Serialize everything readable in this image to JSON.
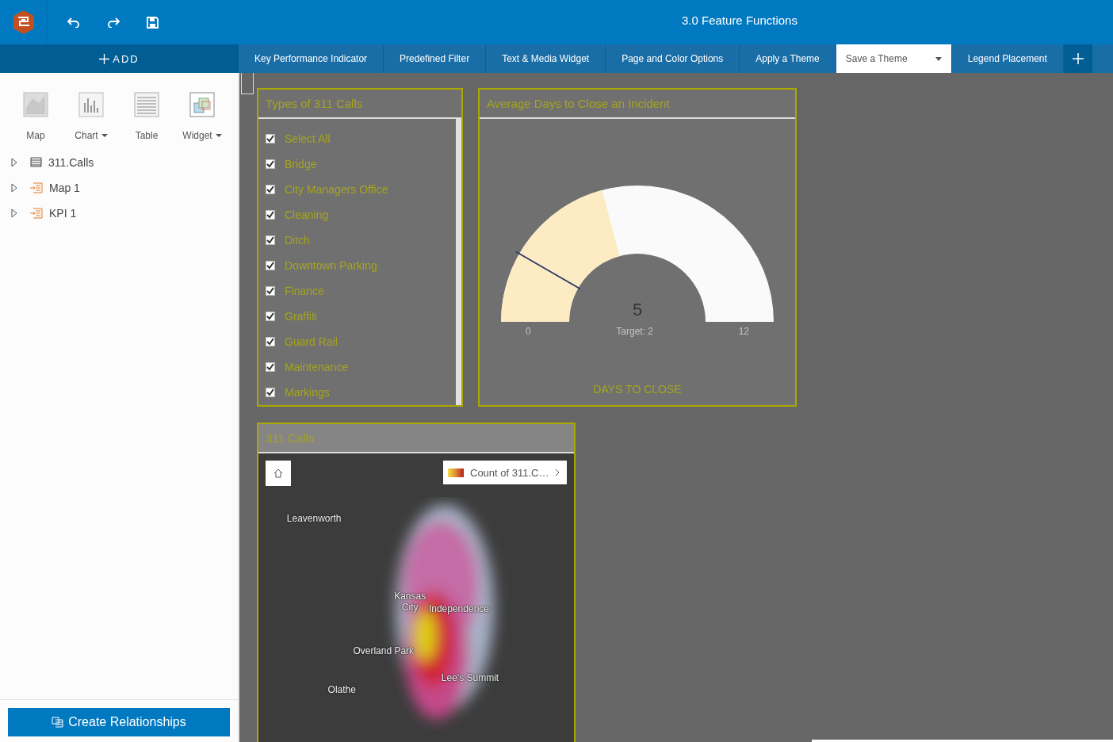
{
  "header": {
    "title": "3.0 Feature Functions"
  },
  "add_button": {
    "label": "ADD"
  },
  "tabs": [
    {
      "label": "Key Performance Indicator",
      "selected": false,
      "kind": "tab"
    },
    {
      "label": "Predefined Filter",
      "selected": false,
      "kind": "tab"
    },
    {
      "label": "Text & Media Widget",
      "selected": false,
      "kind": "tab"
    },
    {
      "label": "Page and Color Options",
      "selected": false,
      "kind": "tab"
    },
    {
      "label": "Apply a Theme",
      "selected": false,
      "kind": "tab"
    },
    {
      "label": "Save a Theme",
      "selected": true,
      "kind": "dropdown"
    },
    {
      "label": "Legend Placement",
      "selected": false,
      "kind": "tab"
    }
  ],
  "tools": [
    {
      "label": "Map",
      "kind": "map",
      "dropdown": false
    },
    {
      "label": "Chart",
      "kind": "chart",
      "dropdown": true
    },
    {
      "label": "Table",
      "kind": "table",
      "dropdown": false
    },
    {
      "label": "Widget",
      "kind": "widget",
      "dropdown": true
    }
  ],
  "tree": [
    {
      "label": "311.Calls",
      "kind": "dataset",
      "expanded": false
    },
    {
      "label": "Map 1",
      "kind": "layer",
      "expanded": false
    },
    {
      "label": "KPI 1",
      "kind": "layer",
      "expanded": false
    }
  ],
  "create_button": {
    "label": "Create Relationships"
  },
  "category_panel": {
    "title": "Types of 311 Calls",
    "items": [
      {
        "label": "Select All",
        "checked": true
      },
      {
        "label": "Bridge",
        "checked": true
      },
      {
        "label": "City Managers Office",
        "checked": true
      },
      {
        "label": "Cleaning",
        "checked": true
      },
      {
        "label": "Ditch",
        "checked": true
      },
      {
        "label": "Downtown Parking",
        "checked": true
      },
      {
        "label": "Finance",
        "checked": true
      },
      {
        "label": "Graffiti",
        "checked": true
      },
      {
        "label": "Guard Rail",
        "checked": true
      },
      {
        "label": "Maintenance",
        "checked": true
      },
      {
        "label": "Markings",
        "checked": true
      }
    ]
  },
  "gauge_panel": {
    "title": "Average Days to Close an Incident",
    "value": "5",
    "level": 0.4167,
    "min": "0",
    "max": "12",
    "target": "Target: 2",
    "caption": "DAYS TO CLOSE"
  },
  "map_panel": {
    "title": "311 Calls",
    "legend": "Count of 311.C…",
    "places": [
      {
        "label": "Leavenworth"
      },
      {
        "label": "Kansas\nCity"
      },
      {
        "label": "Independence"
      },
      {
        "label": "Overland Park"
      },
      {
        "label": "Lee's Summit"
      },
      {
        "label": "Olathe"
      }
    ]
  }
}
